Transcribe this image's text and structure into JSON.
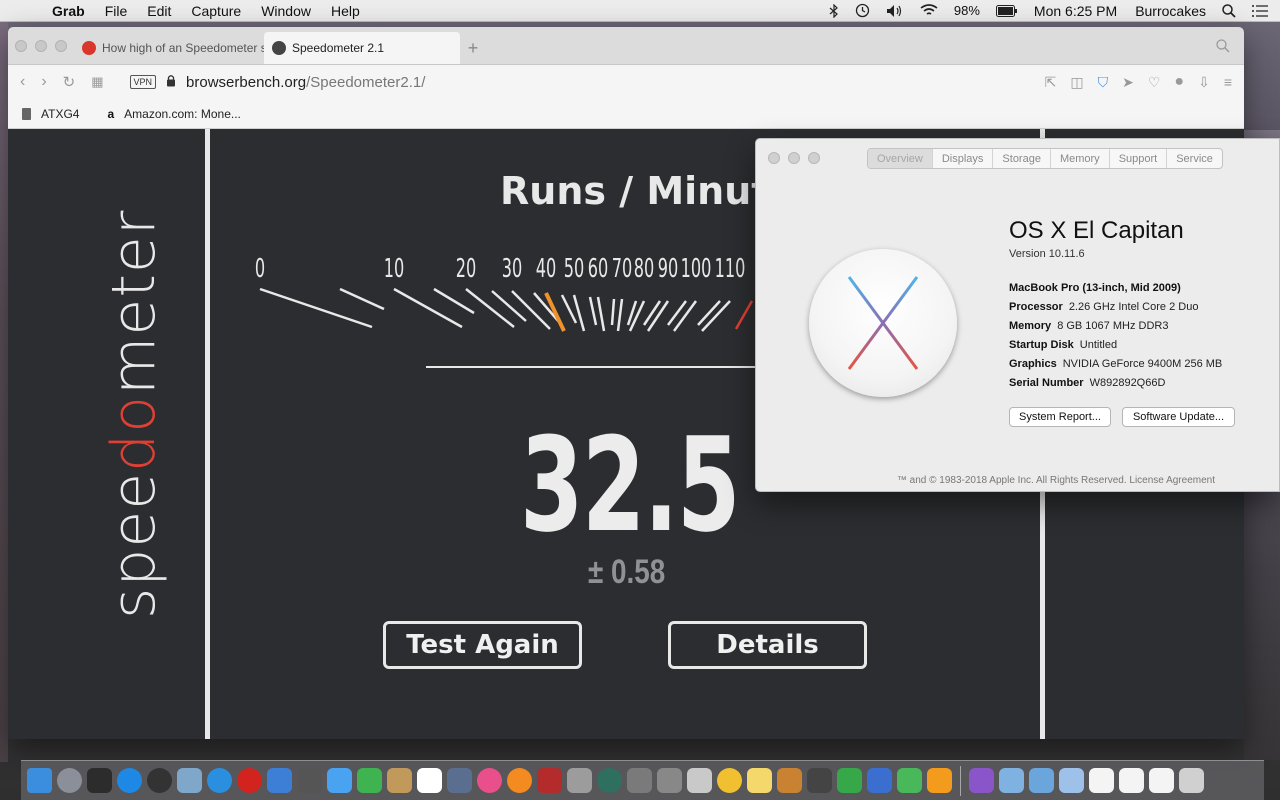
{
  "menubar": {
    "app_name": "Grab",
    "items": [
      "File",
      "Edit",
      "Capture",
      "Window",
      "Help"
    ],
    "battery": "98%",
    "clock": "Mon 6:25 PM",
    "user": "Burrocakes"
  },
  "browser": {
    "tabs": [
      {
        "title": "How high of an Speedometer s",
        "favicon": "red-apple-icon"
      },
      {
        "title": "Speedometer 2.1",
        "favicon": "globe-icon"
      }
    ],
    "url": {
      "host": "browserbench.org",
      "path": "/Speedometer2.1/"
    },
    "vpn_label": "VPN",
    "bookmarks": [
      {
        "label": "ATXG4",
        "icon": "document-icon"
      },
      {
        "label": "Amazon.com: Mone...",
        "icon": "amazon-icon"
      }
    ]
  },
  "speedometer": {
    "brand_pre": "spee",
    "brand_do": "do",
    "brand_post": "meter",
    "title": "Runs / Minute",
    "ticks": [
      "0",
      "10",
      "20",
      "30",
      "40",
      "50",
      "60",
      "70",
      "80",
      "90",
      "100",
      "110"
    ],
    "score": "32.5",
    "error": "± 0.58",
    "test_again_label": "Test Again",
    "details_label": "Details",
    "colors": {
      "accent_red": "#e04034",
      "needle": "#f0922b",
      "bg": "#2b2d30"
    }
  },
  "about_mac": {
    "tabs": [
      "Overview",
      "Displays",
      "Storage",
      "Memory",
      "Support",
      "Service"
    ],
    "selected_tab": "Overview",
    "os_name_a": "OS X",
    "os_name_b": "El Capitan",
    "version": "Version 10.11.6",
    "model": "MacBook Pro (13-inch, Mid 2009)",
    "specs": [
      {
        "key": "Processor",
        "value": "2.26 GHz Intel Core 2 Duo"
      },
      {
        "key": "Memory",
        "value": "8 GB 1067 MHz DDR3"
      },
      {
        "key": "Startup Disk",
        "value": "Untitled"
      },
      {
        "key": "Graphics",
        "value": "NVIDIA GeForce 9400M 256 MB"
      },
      {
        "key": "Serial Number",
        "value": "W892892Q66D"
      }
    ],
    "system_report_label": "System Report...",
    "software_update_label": "Software Update...",
    "copyright": "™ and © 1983-2018 Apple Inc. All Rights Reserved. License Agreement"
  },
  "dock": {
    "apps": [
      "Finder",
      "Launchpad",
      "Activity Monitor",
      "App Store",
      "Dashboard",
      "Preview",
      "Safari",
      "Opera",
      "Airmail",
      "Alien",
      "Messages",
      "FaceTime",
      "Contacts",
      "Calendar",
      "Image Capture",
      "iTunes",
      "iBooks",
      "Photo Booth",
      "Script Editor",
      "Time Machine",
      "System Preferences",
      "Automator",
      "Image Viewer",
      "Photos",
      "Stickies",
      "Keynote",
      "Brush",
      "Numbers",
      "Ink",
      "Grapher",
      "Pages",
      "Tool",
      "Folder",
      "Downloads",
      "Applications",
      "Document 1",
      "Document 2",
      "Document 3",
      "Trash"
    ],
    "colors": [
      "#3b8ede",
      "#8a8f99",
      "#2c2c2c",
      "#1e88e5",
      "#333",
      "#7fa7c9",
      "#2b8fe0",
      "#d2231f",
      "#3d7fd6",
      "#555",
      "#4aa3f0",
      "#3fb34f",
      "#c19a5b",
      "#ffffff",
      "#5a6f8f",
      "#e94f8a",
      "#f38b21",
      "#b32b2b",
      "#9c9c9c",
      "#2f6f5f",
      "#7a7a7a",
      "#888",
      "#c9c9c9",
      "#f0c030",
      "#f5d86b",
      "#c98132",
      "#444",
      "#36a84a",
      "#3a6fd0",
      "#49b85a",
      "#f29b1c",
      "#8a55c9",
      "#7fb2e0",
      "#6aa5dc",
      "#9dc1e8",
      "#f4f4f4",
      "#f4f4f4",
      "#f4f4f4",
      "#d0d0d0"
    ]
  }
}
